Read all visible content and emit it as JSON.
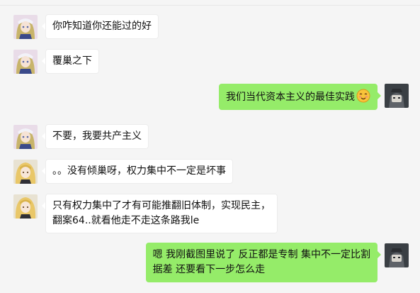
{
  "colors": {
    "background": "#f5f5f5",
    "bubble_received": "#ffffff",
    "bubble_sent": "#95ec69"
  },
  "messages": [
    {
      "side": "left",
      "avatar": "anime-girl-avatar",
      "lines": [
        "你咋知道你还能过的好"
      ]
    },
    {
      "side": "left",
      "avatar": "anime-girl-avatar",
      "lines": [
        "覆巢之下"
      ]
    },
    {
      "side": "right",
      "avatar": "self-avatar",
      "lines": [
        "我们当代资本主义的最佳实践"
      ],
      "emoji": "smiling-face-emoji"
    },
    {
      "side": "left",
      "avatar": "anime-girl-avatar",
      "lines": [
        "不要，我要共产主义"
      ]
    },
    {
      "side": "left",
      "avatar": "blonde-character-avatar",
      "lines": [
        "。。没有倾巢呀，权力集中不一定是坏事"
      ]
    },
    {
      "side": "left",
      "avatar": "blonde-character-avatar",
      "lines": [
        "只有权力集中了才有可能推翻旧体制，实现民主，",
        "翻案64..就看他走不走这条路我le"
      ]
    },
    {
      "side": "right",
      "avatar": "self-avatar",
      "lines": [
        "嗯 我刚截图里说了 反正都是专制 集中不一定比割",
        "据差 还要看下一步怎么走"
      ]
    }
  ]
}
